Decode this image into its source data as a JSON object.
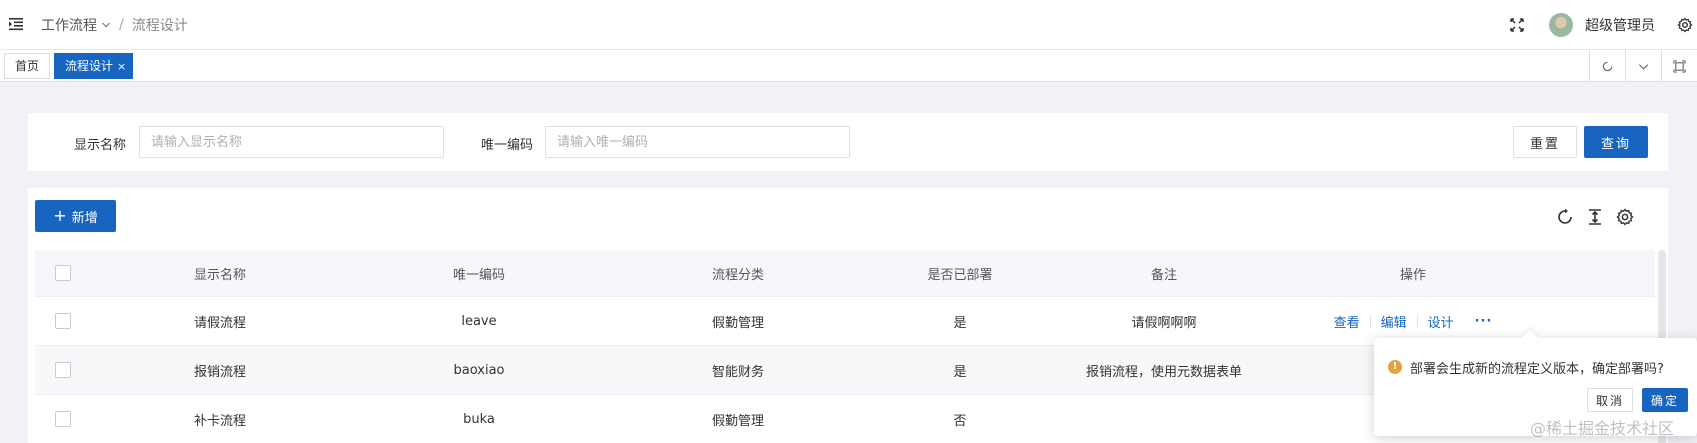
{
  "header": {
    "breadcrumb": [
      "工作流程",
      "流程设计"
    ],
    "breadcrumb_sep": "/",
    "username": "超级管理员"
  },
  "tabs": [
    {
      "label": "首页",
      "active": false
    },
    {
      "label": "流程设计",
      "active": true,
      "close": "×"
    }
  ],
  "search": {
    "name_label": "显示名称",
    "name_placeholder": "请输入显示名称",
    "code_label": "唯一编码",
    "code_placeholder": "请输入唯一编码",
    "reset_label": "重置",
    "query_label": "查询"
  },
  "toolbar": {
    "add_label": "新增"
  },
  "table": {
    "columns": [
      "显示名称",
      "唯一编码",
      "流程分类",
      "是否已部署",
      "备注",
      "操作"
    ],
    "rows": [
      {
        "name": "请假流程",
        "code": "leave",
        "category": "假勤管理",
        "deployed": "是",
        "remark": "请假啊啊啊"
      },
      {
        "name": "报销流程",
        "code": "baoxiao",
        "category": "智能财务",
        "deployed": "是",
        "remark": "报销流程，使用元数据表单"
      },
      {
        "name": "补卡流程",
        "code": "buka",
        "category": "假勤管理",
        "deployed": "否",
        "remark": ""
      }
    ],
    "actions": {
      "view": "查看",
      "edit": "编辑",
      "design": "设计",
      "more": "···"
    }
  },
  "popconfirm": {
    "icon": "!",
    "message": "部署会生成新的流程定义版本，确定部署吗?",
    "cancel_label": "取消",
    "ok_label": "确定"
  },
  "watermark": "@稀土掘金技术社区",
  "colors": {
    "primary": "#1765c0",
    "warning": "#e6a23c"
  }
}
